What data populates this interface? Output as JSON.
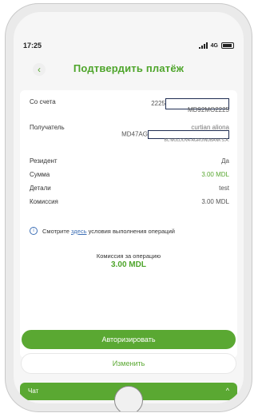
{
  "status": {
    "time": "17:25",
    "network": "4G"
  },
  "header": {
    "back_icon": "chevron-left-icon",
    "title": "Подтвердить платёж"
  },
  "details": {
    "from_label": "Со счета",
    "from_line1": "2225",
    "from_line2": "MD92MO2225",
    "recipient_label": "Получатель",
    "recipient_name": "curtian aliona",
    "recipient_account": "MD47AG",
    "recipient_bank": "BC'MOLDOVA-AGROINDBANK'S.A.",
    "resident_label": "Резидент",
    "resident_value": "Да",
    "amount_label": "Сумма",
    "amount_value": "3.00 MDL",
    "details_label": "Детали",
    "details_value": "test",
    "commission_label": "Комиссия",
    "commission_value": "3.00 MDL"
  },
  "info": {
    "prefix": "Смотрите",
    "link": "здесь",
    "suffix": "условия выполнения операций"
  },
  "fee": {
    "label": "Комиссия за операцию",
    "value": "3.00 MDL"
  },
  "buttons": {
    "authorize": "Авторизировать",
    "change": "Изменить"
  },
  "chat": {
    "label": "Чат"
  },
  "colors": {
    "accent": "#5aa832",
    "link": "#3d6fb5",
    "mask_border": "#1f2d52"
  }
}
